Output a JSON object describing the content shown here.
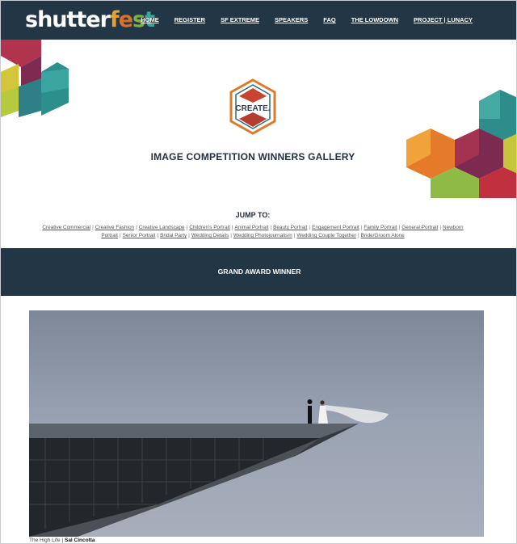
{
  "logo": {
    "part1": "shutter",
    "part2": [
      "f",
      "e",
      "s",
      "t"
    ]
  },
  "nav": [
    {
      "label": "HOME"
    },
    {
      "label": "REGISTER"
    },
    {
      "label": "SF EXTREME"
    },
    {
      "label": "SPEAKERS"
    },
    {
      "label": "FAQ"
    },
    {
      "label": "THE LOWDOWN"
    },
    {
      "label": "PROJECT | LUNACY"
    }
  ],
  "badge": {
    "text": "CREATE."
  },
  "gallery": {
    "title": "IMAGE COMPETITION WINNERS GALLERY"
  },
  "jump": {
    "title": "JUMP TO:",
    "links": [
      "Creative Commercial",
      "Creative Fashion",
      "Creative Landscape",
      "Children's Portrait",
      "Animal Portrait",
      "Beauty Portrait",
      "Engagement Portrait",
      "Family Portrait",
      "General Portrait",
      "Newborn Portrait",
      "Senior Portrait",
      "Bridal Party",
      "Wedding Details",
      "Wedding Photojournalism",
      "Wedding Couple Together",
      "Bride/Groom Alone"
    ]
  },
  "band": {
    "title": "GRAND AWARD WINNER"
  },
  "photo": {
    "title": "The High Life",
    "separator": " | ",
    "author": "Sal Cincotta"
  },
  "colors": {
    "header_bg": "#233646",
    "sky": "#8f9aab",
    "accent_orange": "#e07a2a",
    "accent_teal": "#3aa6a0",
    "accent_green": "#7fae45"
  }
}
